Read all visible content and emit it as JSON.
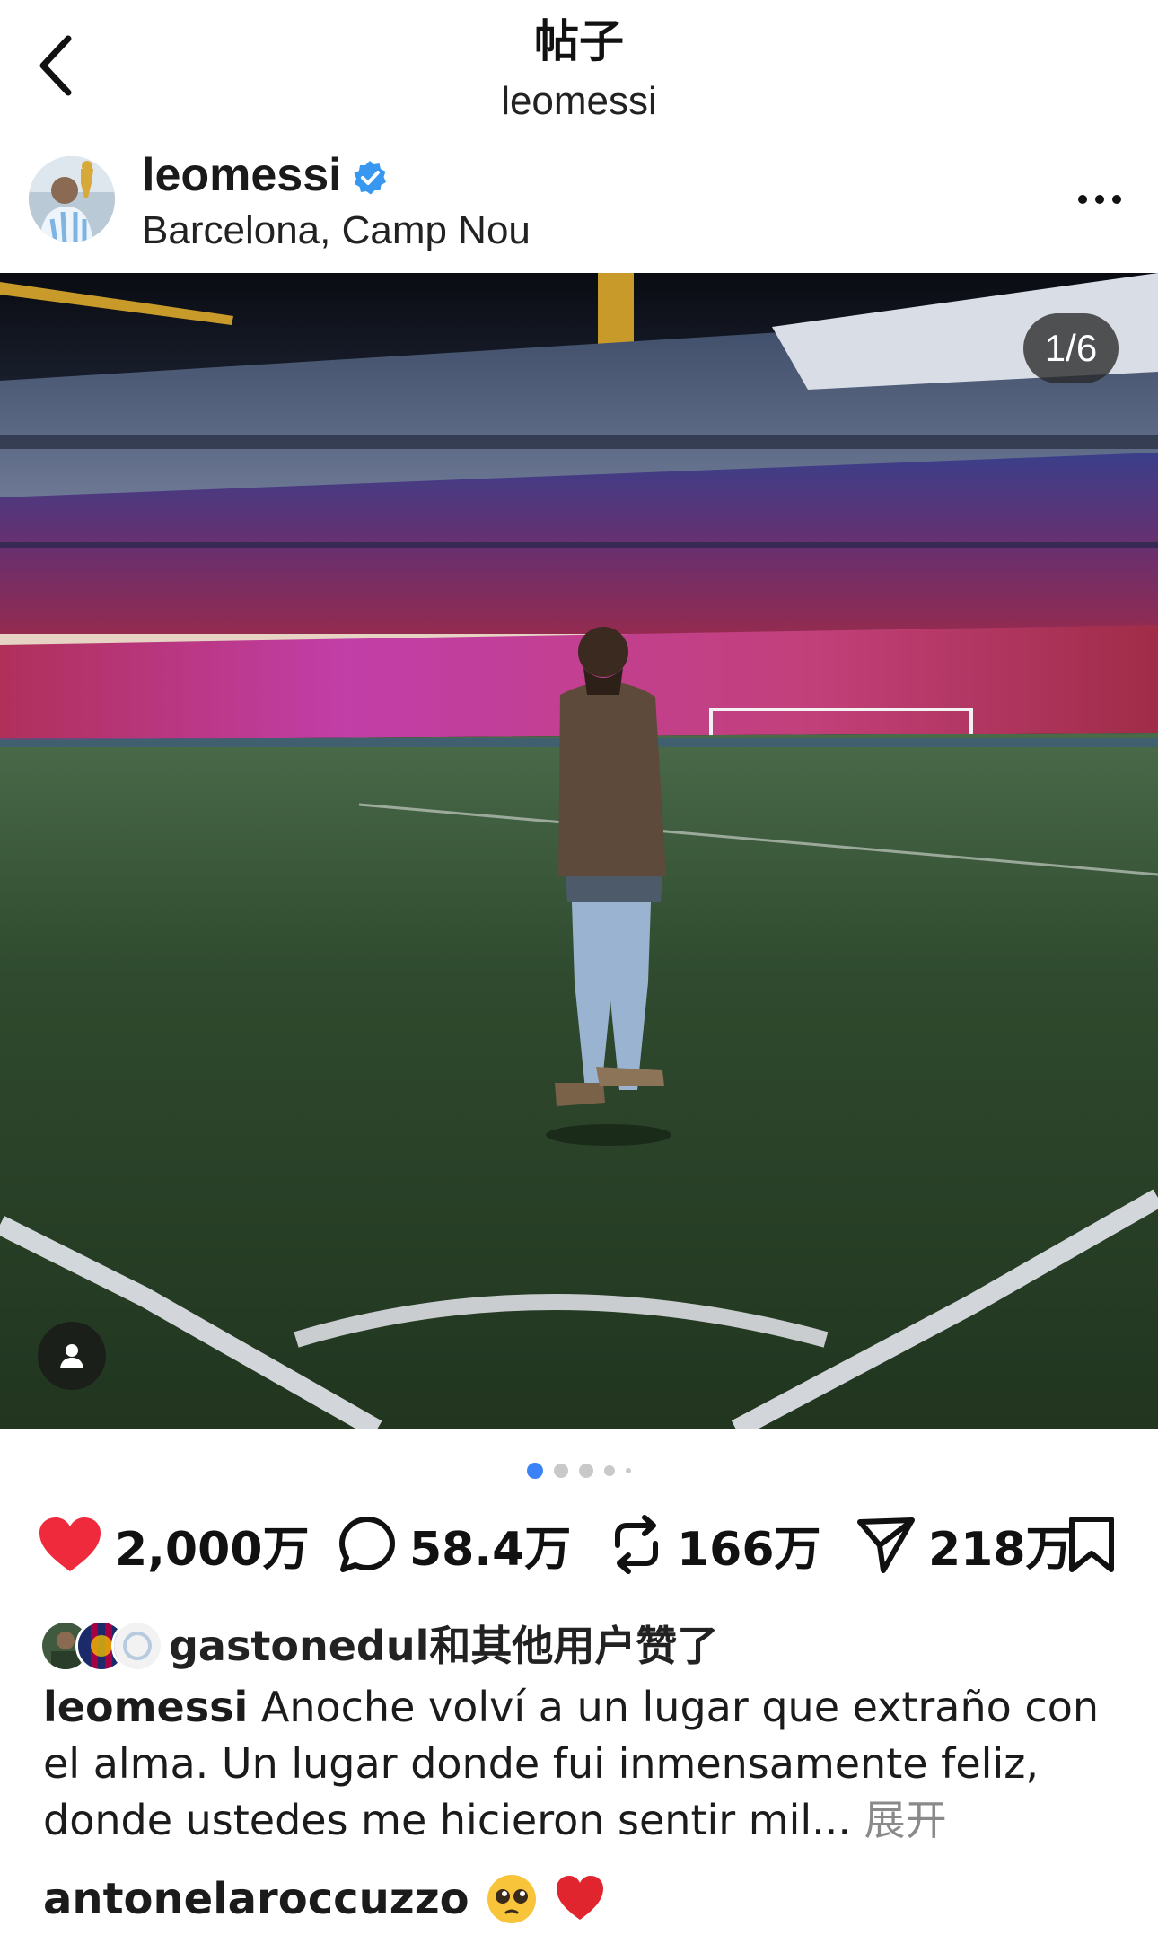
{
  "nav": {
    "title": "帖子",
    "subtitle": "leomessi"
  },
  "post": {
    "username": "leomessi",
    "location": "Barcelona, Camp Nou",
    "image_counter": "1/6",
    "carousel": {
      "total_dots_visible": 5,
      "active_index": 0
    }
  },
  "actions": {
    "likes": "2,000万",
    "comments": "58.4万",
    "reposts": "166万",
    "shares": "218万"
  },
  "liked_by": {
    "text": "gastonedul和其他用户赞了"
  },
  "caption": {
    "username": "leomessi",
    "text": " Anoche volví a un lugar que extraño con el alma. Un lugar donde fui inmensamente feliz, donde ustedes me hicieron sentir mil... ",
    "expand_label": "展开"
  },
  "comment_preview": {
    "username": "antonelaroccuzzo",
    "emojis": [
      "pleading-face",
      "red-heart"
    ]
  },
  "colors": {
    "like_red": "#ee2a3c",
    "verified_blue": "#3897f0",
    "active_dot": "#3b82f6"
  },
  "icons": [
    "back-chevron-icon",
    "verified-badge-icon",
    "more-dots-icon",
    "heart-icon",
    "comment-icon",
    "repost-icon",
    "share-icon",
    "bookmark-icon",
    "person-tag-icon"
  ]
}
